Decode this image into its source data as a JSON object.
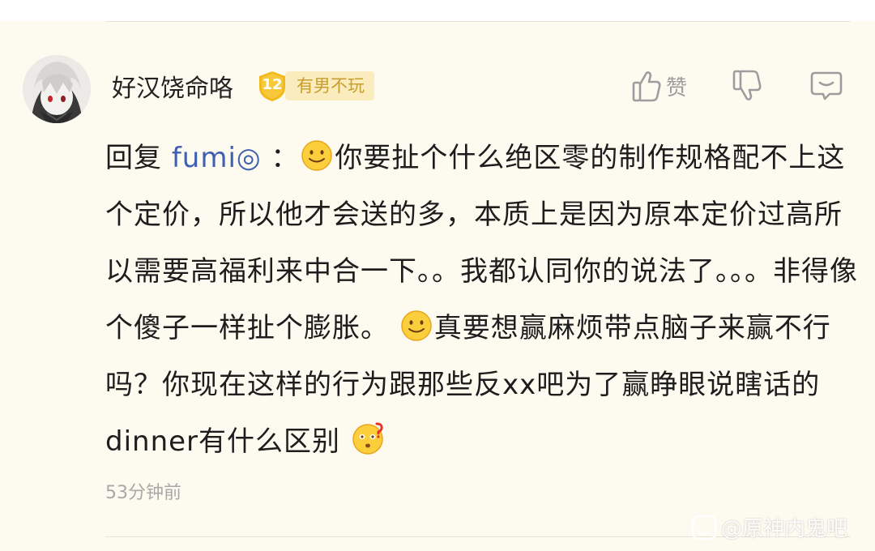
{
  "comment": {
    "username": "好汉饶命咯",
    "level": "12",
    "badge_title": "有男不玩",
    "like_label": "赞",
    "reply_prefix": "回复",
    "mention_name": "fumi◎",
    "colon": "：",
    "segments": [
      "你要扯个什么绝区零的制作规格配不上这个定价，所以他才会送的多，本质上是因为原本定价过高所以需要高福利来中合一下。。我都认同你的说法了。。。非得像个傻子一样扯个膨胀。",
      "真要想赢麻烦带点脑子来赢不行吗？你现在这样的行为跟那些反xx吧为了赢睁眼说瞎话的dinner有什么区别"
    ],
    "timestamp": "53分钟前"
  },
  "watermark": {
    "text": "@原神内鬼吧"
  },
  "colors": {
    "background": "#fdfbf0",
    "mention": "#3f5fb0",
    "badge_bg": "#fbecbd",
    "badge_text": "#c79e2e",
    "level_badge": "#f2b91f",
    "icon_gray": "#9d9d9d"
  }
}
